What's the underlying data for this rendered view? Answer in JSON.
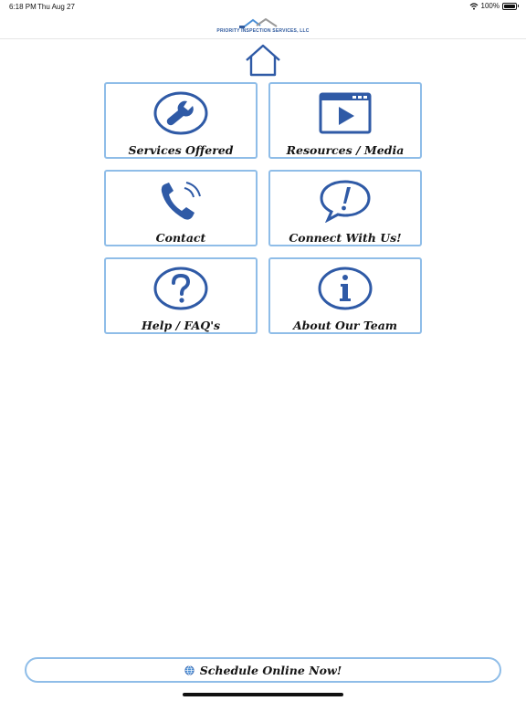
{
  "status_bar": {
    "time": "6:18 PM",
    "date": "Thu Aug 27",
    "battery": "100%",
    "wifi_icon": "wifi-icon",
    "battery_icon": "battery-icon"
  },
  "header": {
    "logo_title": "PRIORITY INSPECTION SERVICES, LLC",
    "logo_icon": "house-roof-logo"
  },
  "home_icon": "home-icon",
  "tiles": [
    {
      "label": "Services Offered",
      "icon": "wrench-icon"
    },
    {
      "label": "Resources / Media",
      "icon": "video-play-icon"
    },
    {
      "label": "Contact",
      "icon": "phone-icon"
    },
    {
      "label": "Connect With Us!",
      "icon": "chat-exclamation-icon"
    },
    {
      "label": "Help / FAQ's",
      "icon": "question-icon"
    },
    {
      "label": "About Our Team",
      "icon": "info-icon"
    }
  ],
  "schedule": {
    "label": "Schedule Online Now!",
    "icon": "globe-icon"
  },
  "colors": {
    "accent": "#2f5aa6",
    "tile_border": "#8fbde8"
  }
}
